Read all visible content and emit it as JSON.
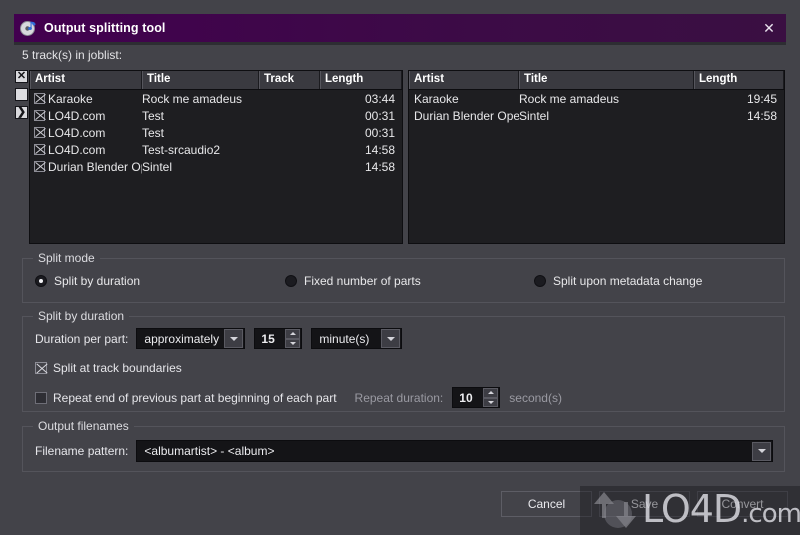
{
  "window": {
    "title": "Output splitting tool",
    "title_icon": "disc-music-note-icon",
    "close_label": "✕",
    "accent_color": "#3b0a47",
    "body_color": "#434349"
  },
  "joblist": {
    "count_label": "5 track(s) in joblist:",
    "side_buttons": [
      {
        "name": "select-all-toggle",
        "glyph": "✕",
        "state": "checked"
      },
      {
        "name": "select-none-toggle",
        "glyph": "",
        "state": "unchecked"
      },
      {
        "name": "invert-selection-toggle",
        "glyph": "❯",
        "state": "partial"
      }
    ],
    "left_table": {
      "columns": [
        "Artist",
        "Title",
        "Track",
        "Length"
      ],
      "rows": [
        {
          "checked": true,
          "artist": "Karaoke",
          "title": "Rock me amadeus",
          "track": "",
          "length": "03:44"
        },
        {
          "checked": true,
          "artist": "LO4D.com",
          "title": "Test",
          "track": "",
          "length": "00:31"
        },
        {
          "checked": true,
          "artist": "LO4D.com",
          "title": "Test",
          "track": "",
          "length": "00:31"
        },
        {
          "checked": true,
          "artist": "LO4D.com",
          "title": "Test-srcaudio2",
          "track": "",
          "length": "14:58"
        },
        {
          "checked": true,
          "artist": "Durian Blender Open",
          "title": "Sintel",
          "track": "",
          "length": "14:58"
        }
      ]
    },
    "right_table": {
      "columns": [
        "Artist",
        "Title",
        "Length"
      ],
      "rows": [
        {
          "artist": "Karaoke",
          "title": "Rock me amadeus",
          "length": "19:45"
        },
        {
          "artist": "Durian Blender Open",
          "title": "Sintel",
          "length": "14:58"
        }
      ]
    }
  },
  "split_mode": {
    "group_title": "Split mode",
    "options": [
      {
        "label": "Split by duration",
        "selected": true
      },
      {
        "label": "Fixed number of parts",
        "selected": false
      },
      {
        "label": "Split upon metadata change",
        "selected": false
      }
    ]
  },
  "split_by_duration": {
    "group_title": "Split by duration",
    "duration_label": "Duration per part:",
    "approx_value": "approximately",
    "amount_value": "15",
    "unit_value": "minute(s)",
    "split_at_boundaries": {
      "label": "Split at track boundaries",
      "checked": true
    },
    "repeat_end": {
      "label": "Repeat end of previous part at beginning of each part",
      "checked": false
    },
    "repeat_duration_label": "Repeat duration:",
    "repeat_duration_value": "10",
    "repeat_duration_unit": "second(s)"
  },
  "output_filenames": {
    "group_title": "Output filenames",
    "pattern_label": "Filename pattern:",
    "pattern_value": "<albumartist> - <album>"
  },
  "buttons": {
    "cancel": "Cancel",
    "save": "Save",
    "convert": "Convert"
  },
  "watermark": {
    "text_main": "LO4D",
    "text_suffix": ".com"
  }
}
